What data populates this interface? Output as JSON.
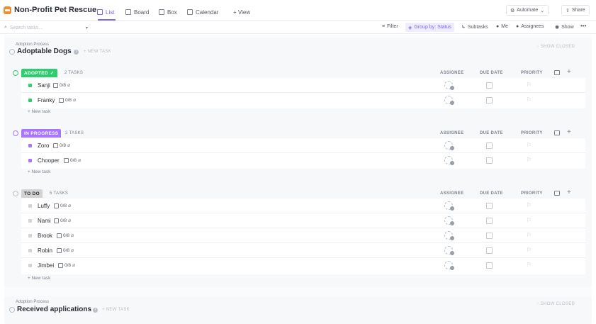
{
  "header": {
    "title": "Non-Profit Pet Rescue",
    "tabs": [
      {
        "label": "List",
        "icon": "list-icon"
      },
      {
        "label": "Board",
        "icon": "board-icon"
      },
      {
        "label": "Box",
        "icon": "box-icon"
      },
      {
        "label": "Calendar",
        "icon": "calendar-icon"
      }
    ],
    "add_view": "+ View",
    "automate": "Automate",
    "share": "Share",
    "accent": "#7b68ee"
  },
  "toolbar": {
    "search_placeholder": "Search tasks...",
    "filter": "Filter",
    "group_by": "Group by: Status",
    "subtasks": "Subtasks",
    "me": "Me",
    "assignees": "Assignees",
    "show": "Show",
    "more": "•••"
  },
  "sections": [
    {
      "subtitle": "Adoption Process",
      "title": "Adoptable Dogs",
      "new_task": "+ NEW TASK",
      "show_closed": "SHOW CLOSED",
      "groups": [
        {
          "status": "ADOPTED",
          "color": "#2ecd6f",
          "count": "2 TASKS",
          "col_assignee": "ASSIGNEE",
          "col_due": "DUE DATE",
          "col_priority": "PRIORITY",
          "tasks": [
            {
              "name": "Sanji",
              "subtasks": "0/8"
            },
            {
              "name": "Franky",
              "subtasks": "0/8"
            }
          ],
          "new_task": "+ New task"
        },
        {
          "status": "IN PROGRESS",
          "color": "#a875ff",
          "count": "2 TASKS",
          "col_assignee": "ASSIGNEE",
          "col_due": "DUE DATE",
          "col_priority": "PRIORITY",
          "tasks": [
            {
              "name": "Zoro",
              "subtasks": "0/8"
            },
            {
              "name": "Chooper",
              "subtasks": "0/8"
            }
          ],
          "new_task": "+ New task"
        },
        {
          "status": "TO DO",
          "color": "#d3d3d3",
          "count": "5 TASKS",
          "col_assignee": "ASSIGNEE",
          "col_due": "DUE DATE",
          "col_priority": "PRIORITY",
          "tasks": [
            {
              "name": "Luffy",
              "subtasks": "0/8"
            },
            {
              "name": "Nami",
              "subtasks": "0/8"
            },
            {
              "name": "Brook",
              "subtasks": "0/8"
            },
            {
              "name": "Robin",
              "subtasks": "0/8"
            },
            {
              "name": "Jimbei",
              "subtasks": "0/8"
            }
          ],
          "new_task": "+ New task"
        }
      ]
    },
    {
      "subtitle": "Adoption Process",
      "title": "Received applications",
      "new_task": "+ NEW TASK",
      "show_closed": "SHOW CLOSED"
    }
  ]
}
